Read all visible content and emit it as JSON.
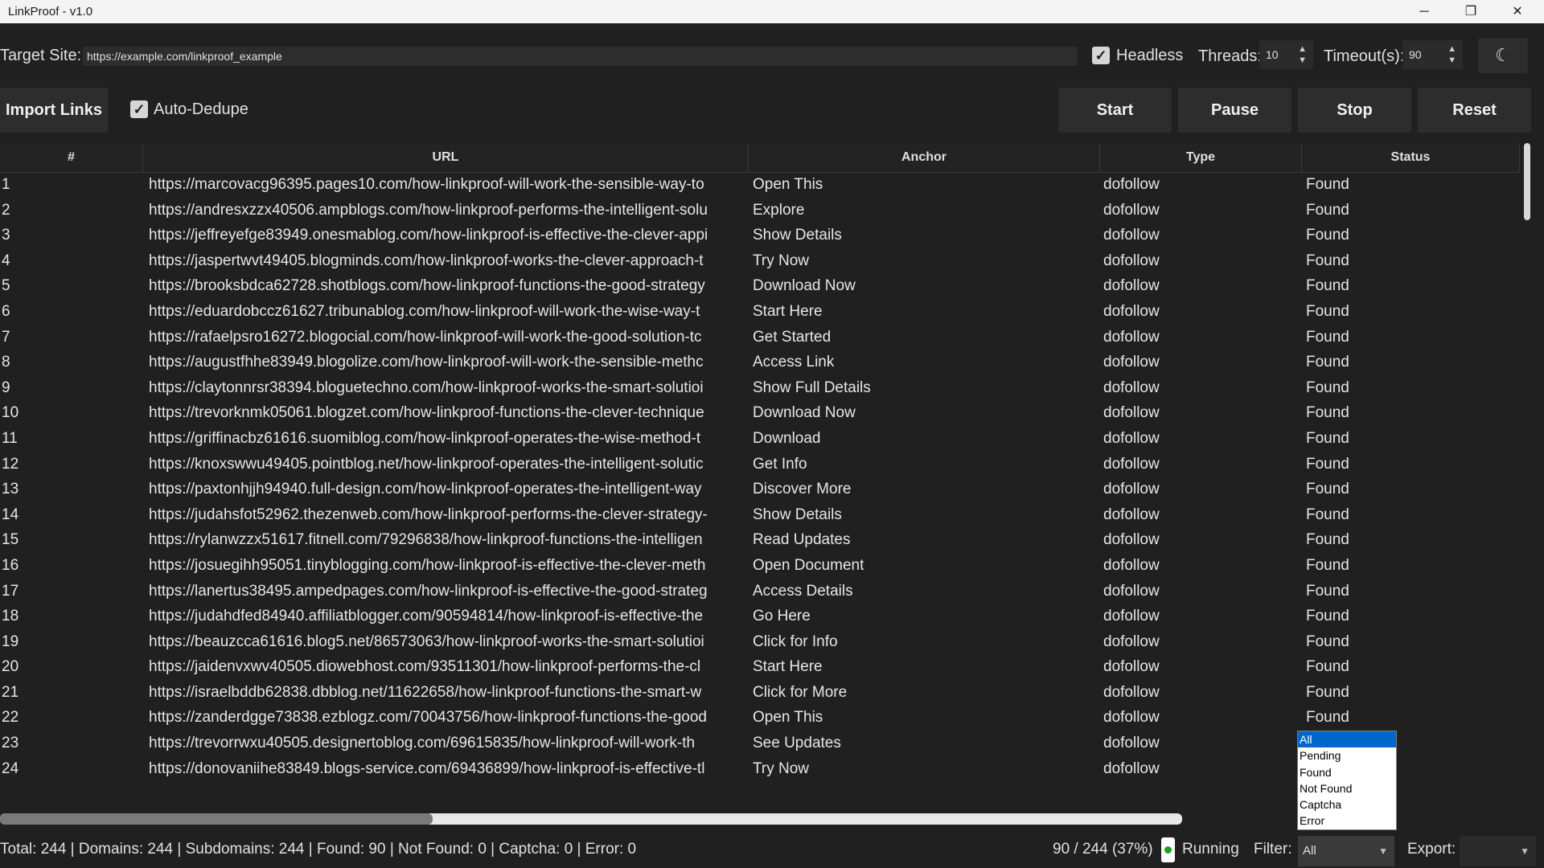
{
  "window": {
    "title": "LinkProof - v1.0",
    "min": "─",
    "max": "❐",
    "close": "✕"
  },
  "toolbar": {
    "target_label": "Target Site:",
    "target_value": "https://example.com/linkproof_example",
    "headless_label": "Headless",
    "headless_checked": true,
    "threads_label": "Threads:",
    "threads_value": "10",
    "timeout_label": "Timeout(s):",
    "timeout_value": "90",
    "theme_icon": "moon-icon",
    "import_label": "Import Links",
    "autodedupe_label": "Auto-Dedupe",
    "autodedupe_checked": true,
    "start_label": "Start",
    "pause_label": "Pause",
    "stop_label": "Stop",
    "reset_label": "Reset"
  },
  "table": {
    "headers": [
      "#",
      "URL",
      "Anchor",
      "Type",
      "Status"
    ],
    "rows": [
      {
        "num": "1",
        "url": "https://marcovacg96395.pages10.com/how-linkproof-will-work-the-sensible-way-to",
        "anchor": "Open This",
        "type": "dofollow",
        "status": "Found"
      },
      {
        "num": "2",
        "url": "https://andresxzzx40506.ampblogs.com/how-linkproof-performs-the-intelligent-solu",
        "anchor": "Explore",
        "type": "dofollow",
        "status": "Found"
      },
      {
        "num": "3",
        "url": "https://jeffreyefge83949.onesmablog.com/how-linkproof-is-effective-the-clever-appi",
        "anchor": "Show Details",
        "type": "dofollow",
        "status": "Found"
      },
      {
        "num": "4",
        "url": "https://jaspertwvt49405.blogminds.com/how-linkproof-works-the-clever-approach-t",
        "anchor": "Try Now",
        "type": "dofollow",
        "status": "Found"
      },
      {
        "num": "5",
        "url": "https://brooksbdca62728.shotblogs.com/how-linkproof-functions-the-good-strategy",
        "anchor": "Download Now",
        "type": "dofollow",
        "status": "Found"
      },
      {
        "num": "6",
        "url": "https://eduardobccz61627.tribunablog.com/how-linkproof-will-work-the-wise-way-t",
        "anchor": "Start Here",
        "type": "dofollow",
        "status": "Found"
      },
      {
        "num": "7",
        "url": "https://rafaelpsro16272.blogocial.com/how-linkproof-will-work-the-good-solution-tc",
        "anchor": "Get Started",
        "type": "dofollow",
        "status": "Found"
      },
      {
        "num": "8",
        "url": "https://augustfhhe83949.blogolize.com/how-linkproof-will-work-the-sensible-methc",
        "anchor": "Access Link",
        "type": "dofollow",
        "status": "Found"
      },
      {
        "num": "9",
        "url": "https://claytonnrsr38394.bloguetechno.com/how-linkproof-works-the-smart-solutioi",
        "anchor": "Show Full Details",
        "type": "dofollow",
        "status": "Found"
      },
      {
        "num": "10",
        "url": "https://trevorknmk05061.blogzet.com/how-linkproof-functions-the-clever-technique",
        "anchor": "Download Now",
        "type": "dofollow",
        "status": "Found"
      },
      {
        "num": "11",
        "url": "https://griffinacbz61616.suomiblog.com/how-linkproof-operates-the-wise-method-t",
        "anchor": "Download",
        "type": "dofollow",
        "status": "Found"
      },
      {
        "num": "12",
        "url": "https://knoxswwu49405.pointblog.net/how-linkproof-operates-the-intelligent-solutic",
        "anchor": "Get Info",
        "type": "dofollow",
        "status": "Found"
      },
      {
        "num": "13",
        "url": "https://paxtonhjjh94940.full-design.com/how-linkproof-operates-the-intelligent-way",
        "anchor": "Discover More",
        "type": "dofollow",
        "status": "Found"
      },
      {
        "num": "14",
        "url": "https://judahsfot52962.thezenweb.com/how-linkproof-performs-the-clever-strategy-",
        "anchor": "Show Details",
        "type": "dofollow",
        "status": "Found"
      },
      {
        "num": "15",
        "url": "https://rylanwzzx51617.fitnell.com/79296838/how-linkproof-functions-the-intelligen",
        "anchor": "Read Updates",
        "type": "dofollow",
        "status": "Found"
      },
      {
        "num": "16",
        "url": "https://josuegihh95051.tinyblogging.com/how-linkproof-is-effective-the-clever-meth",
        "anchor": "Open Document",
        "type": "dofollow",
        "status": "Found"
      },
      {
        "num": "17",
        "url": "https://lanertus38495.ampedpages.com/how-linkproof-is-effective-the-good-strateg",
        "anchor": "Access Details",
        "type": "dofollow",
        "status": "Found"
      },
      {
        "num": "18",
        "url": "https://judahdfed84940.affiliatblogger.com/90594814/how-linkproof-is-effective-the",
        "anchor": "Go Here",
        "type": "dofollow",
        "status": "Found"
      },
      {
        "num": "19",
        "url": "https://beauzcca61616.blog5.net/86573063/how-linkproof-works-the-smart-solutioi",
        "anchor": "Click for Info",
        "type": "dofollow",
        "status": "Found"
      },
      {
        "num": "20",
        "url": "https://jaidenvxwv40505.diowebhost.com/93511301/how-linkproof-performs-the-cl",
        "anchor": "Start Here",
        "type": "dofollow",
        "status": "Found"
      },
      {
        "num": "21",
        "url": "https://israelbddb62838.dbblog.net/11622658/how-linkproof-functions-the-smart-w",
        "anchor": "Click for More",
        "type": "dofollow",
        "status": "Found"
      },
      {
        "num": "22",
        "url": "https://zanderdgge73838.ezblogz.com/70043756/how-linkproof-functions-the-good",
        "anchor": "Open This",
        "type": "dofollow",
        "status": "Found"
      },
      {
        "num": "23",
        "url": "https://trevorrwxu40505.designertoblog.com/69615835/how-linkproof-will-work-th",
        "anchor": "See Updates",
        "type": "dofollow",
        "status": ""
      },
      {
        "num": "24",
        "url": "https://donovaniihe83849.blogs-service.com/69436899/how-linkproof-is-effective-tl",
        "anchor": "Try Now",
        "type": "dofollow",
        "status": ""
      }
    ],
    "vscroll_fraction": 0.0,
    "hscroll_fraction": 0.0
  },
  "statusbar": {
    "summary": "Total: 244 | Domains: 244 | Subdomains: 244 | Found: 90 | Not Found: 0 | Captcha: 0 | Error: 0",
    "progress": "90 / 244 (37%)",
    "state": "Running",
    "state_color": "#1aa01a",
    "filter_label": "Filter:",
    "filter_value": "All",
    "export_label": "Export:"
  },
  "filter_dropdown": {
    "options": [
      "All",
      "Pending",
      "Found",
      "Not Found",
      "Captcha",
      "Error"
    ],
    "selected": "All"
  }
}
